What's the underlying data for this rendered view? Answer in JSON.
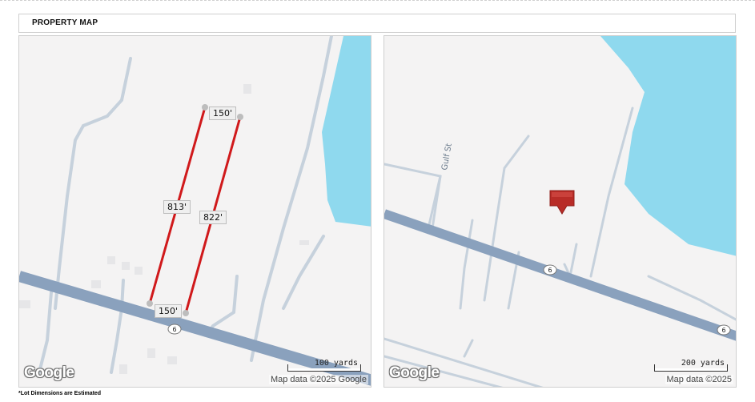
{
  "header": {
    "title": "PROPERTY MAP"
  },
  "footnote": "*Lot Dimensions are Estimated",
  "left_map": {
    "dimensions": {
      "top": "150'",
      "bottom": "150'",
      "left_side": "813'",
      "right_side": "822'"
    },
    "highway_shield": "6",
    "scale_label": "100 yards",
    "attribution": "Map data ©2025 Google",
    "logo": "Google"
  },
  "right_map": {
    "street_label": "Gulf St",
    "highway_shields": [
      "6",
      "6"
    ],
    "scale_label": "200 yards",
    "attribution": "Map data ©2025",
    "logo": "Google",
    "marker_icon": "map-marker-icon"
  },
  "colors": {
    "water": "#8fd9ee",
    "land": "#f4f3f3",
    "highway": "#8aa1bd",
    "minor_road": "#c6d1dc",
    "lot_line": "#d0191b"
  }
}
